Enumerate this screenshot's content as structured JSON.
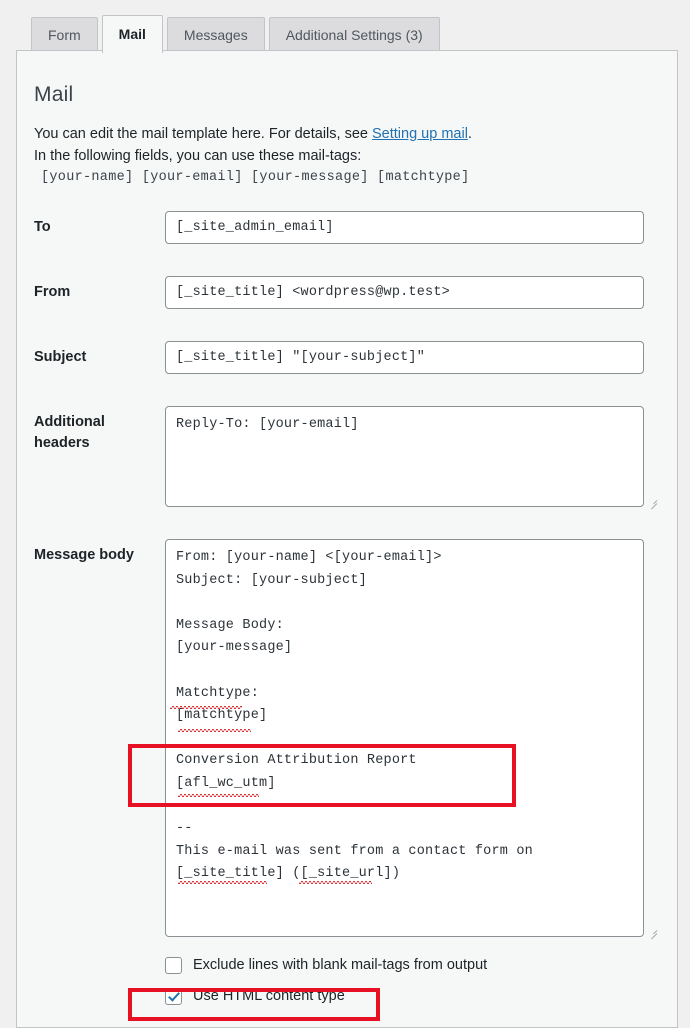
{
  "tabs": [
    {
      "label": "Form",
      "active": false
    },
    {
      "label": "Mail",
      "active": true
    },
    {
      "label": "Messages",
      "active": false
    },
    {
      "label": "Additional Settings (3)",
      "active": false
    }
  ],
  "section": {
    "title": "Mail",
    "intro_prefix": "You can edit the mail template here. For details, see ",
    "intro_link": "Setting up mail",
    "intro_suffix": ".",
    "intro_line2": "In the following fields, you can use these mail-tags:",
    "mail_tags": "[your-name] [your-email] [your-message] [matchtype]"
  },
  "fields": {
    "to_label": "To",
    "to_value": "[_site_admin_email]",
    "from_label": "From",
    "from_value": "[_site_title] <wordpress@wp.test>",
    "subject_label": "Subject",
    "subject_value": "[_site_title] \"[your-subject]\"",
    "headers_label_line1": "Additional",
    "headers_label_line2": "headers",
    "headers_value": "Reply-To: [your-email]",
    "body_label": "Message body",
    "body_value": "From: [your-name] <[your-email]>\nSubject: [your-subject]\n\nMessage Body:\n[your-message]\n\nMatchtype:\n[matchtype]\n\nConversion Attribution Report\n[afl_wc_utm]\n\n--\nThis e-mail was sent from a contact form on\n[_site_title] ([_site_url])"
  },
  "options": {
    "exclude_blank_label": "Exclude lines with blank mail-tags from output",
    "exclude_blank_checked": false,
    "html_content_label": "Use HTML content type",
    "html_content_checked": true
  },
  "annotations": {
    "accent_color": "#e81123",
    "box1_target": "Conversion Attribution Report / [afl_wc_utm]",
    "box2_target": "Use HTML content type"
  }
}
